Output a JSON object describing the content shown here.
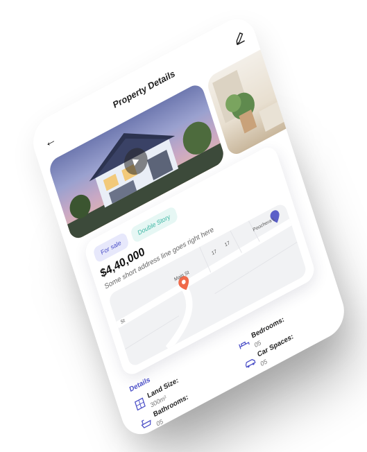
{
  "header": {
    "title": "Property Details",
    "back_icon": "arrow-left-icon",
    "edit_icon": "pencil-icon"
  },
  "listing": {
    "tags": [
      "For sale",
      "Double Story"
    ],
    "price": "$4,40,000",
    "address": "Some short address line goes right here"
  },
  "map": {
    "street_main": "Main St",
    "street_side": "Poochera L",
    "street_left": "St",
    "lot_a": "17",
    "lot_b": "17"
  },
  "details": {
    "heading": "Details",
    "items": [
      {
        "label": "Land Size:",
        "value": "300m²",
        "icon": "land-size-icon"
      },
      {
        "label": "Bedrooms:",
        "value": "05",
        "icon": "bed-icon"
      },
      {
        "label": "Bathrooms:",
        "value": "05",
        "icon": "bathtub-icon"
      },
      {
        "label": "Car Spaces:",
        "value": "05",
        "icon": "car-icon"
      }
    ]
  },
  "colors": {
    "accent": "#4b4fc7",
    "teal": "#3cb6a3",
    "pin": "#f06a4a"
  }
}
